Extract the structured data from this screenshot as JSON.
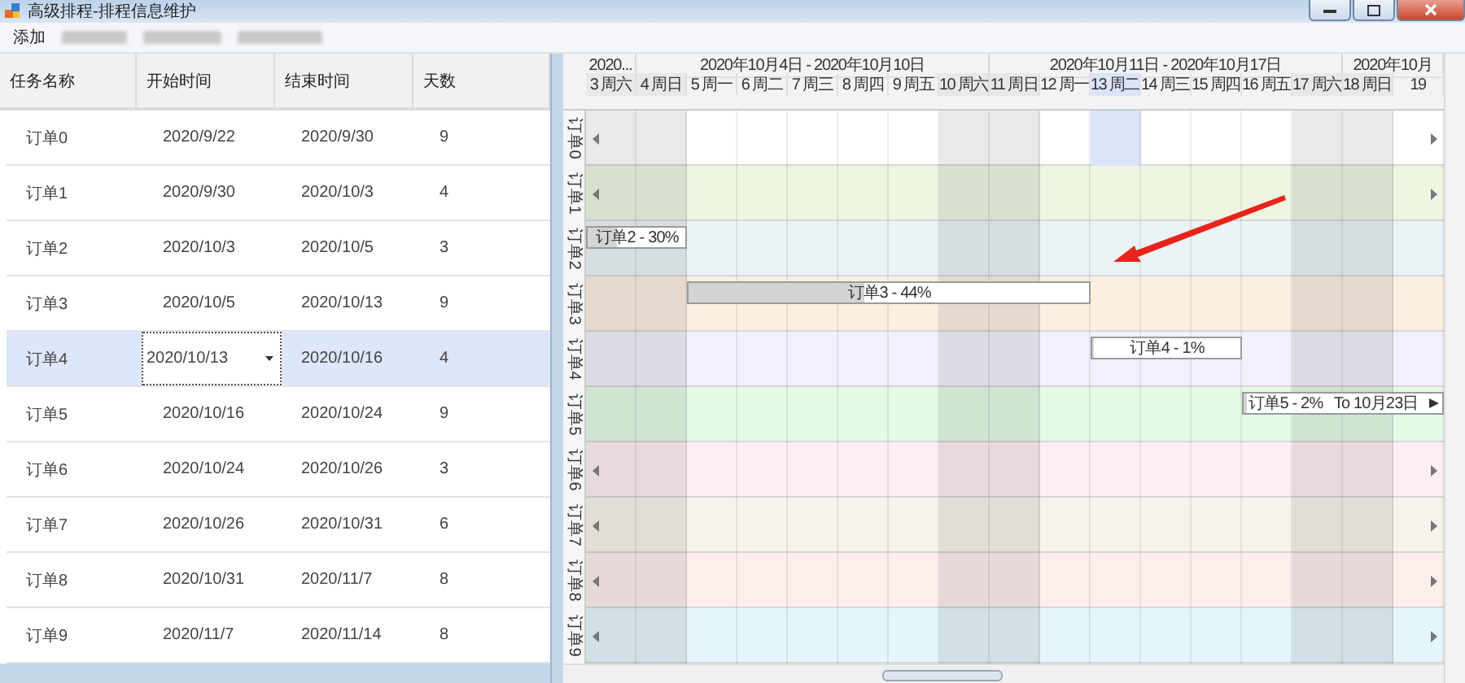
{
  "window": {
    "title": "高级排程-排程信息维护"
  },
  "menu": [
    "添加"
  ],
  "table": {
    "columns": [
      "任务名称",
      "开始时间",
      "结束时间",
      "天数"
    ],
    "rows": [
      {
        "cells": [
          "订单0",
          "2020/9/22",
          "2020/9/30",
          "9"
        ],
        "selected": false,
        "start_editing": false
      },
      {
        "cells": [
          "订单1",
          "2020/9/30",
          "2020/10/3",
          "4"
        ],
        "selected": false,
        "start_editing": false
      },
      {
        "cells": [
          "订单2",
          "2020/10/3",
          "2020/10/5",
          "3"
        ],
        "selected": false,
        "start_editing": false
      },
      {
        "cells": [
          "订单3",
          "2020/10/5",
          "2020/10/13",
          "9"
        ],
        "selected": false,
        "start_editing": false
      },
      {
        "cells": [
          "订单4",
          "2020/10/13",
          "2020/10/16",
          "4"
        ],
        "selected": true,
        "start_editing": true
      },
      {
        "cells": [
          "订单5",
          "2020/10/16",
          "2020/10/24",
          "9"
        ],
        "selected": false,
        "start_editing": false
      },
      {
        "cells": [
          "订单6",
          "2020/10/24",
          "2020/10/26",
          "3"
        ],
        "selected": false,
        "start_editing": false
      },
      {
        "cells": [
          "订单7",
          "2020/10/26",
          "2020/10/31",
          "6"
        ],
        "selected": false,
        "start_editing": false
      },
      {
        "cells": [
          "订单8",
          "2020/10/31",
          "2020/11/7",
          "8"
        ],
        "selected": false,
        "start_editing": false
      },
      {
        "cells": [
          "订单9",
          "2020/11/7",
          "2020/11/14",
          "8"
        ],
        "selected": false,
        "start_editing": false
      }
    ]
  },
  "gantt": {
    "week_groups": [
      {
        "label": "2020...",
        "days": [
          {
            "label": "3 周六",
            "weekend": true,
            "selected": false
          }
        ]
      },
      {
        "label": "2020年10月4日 - 2020年10月10日",
        "days": [
          {
            "label": "4 周日",
            "weekend": true,
            "selected": false
          },
          {
            "label": "5 周一",
            "weekend": false,
            "selected": false
          },
          {
            "label": "6 周二",
            "weekend": false,
            "selected": false
          },
          {
            "label": "7 周三",
            "weekend": false,
            "selected": false
          },
          {
            "label": "8 周四",
            "weekend": false,
            "selected": false
          },
          {
            "label": "9 周五",
            "weekend": false,
            "selected": false
          },
          {
            "label": "10 周六",
            "weekend": true,
            "selected": false
          }
        ]
      },
      {
        "label": "2020年10月11日 - 2020年10月17日",
        "days": [
          {
            "label": "11 周日",
            "weekend": true,
            "selected": false
          },
          {
            "label": "12 周一",
            "weekend": false,
            "selected": false
          },
          {
            "label": "13 周二",
            "weekend": false,
            "selected": true
          },
          {
            "label": "14 周三",
            "weekend": false,
            "selected": false
          },
          {
            "label": "15 周四",
            "weekend": false,
            "selected": false
          },
          {
            "label": "16 周五",
            "weekend": false,
            "selected": false
          },
          {
            "label": "17 周六",
            "weekend": true,
            "selected": false
          }
        ]
      },
      {
        "label": "2020年10月",
        "days": [
          {
            "label": "18 周日",
            "weekend": true,
            "selected": false
          },
          {
            "label": "19",
            "weekend": false,
            "selected": false
          }
        ]
      }
    ],
    "rows": [
      {
        "label": "订单0",
        "color": "#ffffff",
        "selected": true,
        "more_left": true,
        "more_right": true
      },
      {
        "label": "订单1",
        "color": "#eef6e2",
        "selected": false,
        "more_left": true,
        "more_right": true
      },
      {
        "label": "订单2",
        "color": "#eaf3f6",
        "selected": false,
        "more_left": false,
        "more_right": false,
        "bar": {
          "label": "订单2 - 30%",
          "level": 0.3
        }
      },
      {
        "label": "订单3",
        "color": "#fdeee2",
        "selected": false,
        "more_left": false,
        "more_right": false,
        "bar": {
          "label": "订单3 - 44%",
          "level": 0.44
        }
      },
      {
        "label": "订单4",
        "color": "#f3effc",
        "selected": false,
        "more_left": false,
        "more_right": false,
        "bar": {
          "label": "订单4 - 1%",
          "level": 0.01
        }
      },
      {
        "label": "订单5",
        "color": "#e4fae6",
        "selected": false,
        "more_left": false,
        "more_right": false,
        "bar": {
          "label": "订单5 - 2%",
          "level": 0.02,
          "note": "To 10月23日"
        }
      },
      {
        "label": "订单6",
        "color": "#fdeef5",
        "selected": false,
        "more_left": true,
        "more_right": true
      },
      {
        "label": "订单7",
        "color": "#f6f3ec",
        "selected": false,
        "more_left": true,
        "more_right": true
      },
      {
        "label": "订单8",
        "color": "#fdeeec",
        "selected": false,
        "more_left": true,
        "more_right": true
      },
      {
        "label": "订单9",
        "color": "#e4f6fa",
        "selected": false,
        "more_left": true,
        "more_right": true
      }
    ]
  }
}
